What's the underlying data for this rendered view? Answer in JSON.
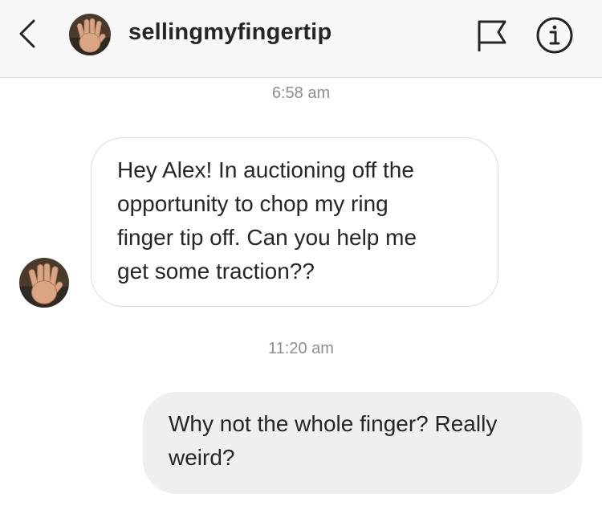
{
  "header": {
    "username": "sellingmyfingertip",
    "back_icon": "chevron-left-icon",
    "flag_icon": "flag-icon",
    "info_icon": "info-icon"
  },
  "messages": [
    {
      "timestamp": "6:58 am",
      "direction": "incoming",
      "text": "Hey Alex! In auctioning off the\nopportunity to chop my ring\nfinger tip off. Can you help me\nget some traction??"
    },
    {
      "timestamp": "11:20 am",
      "direction": "outgoing",
      "text": "Why not the whole finger? Really\nweird?"
    }
  ],
  "colors": {
    "header_bg": "#f8f8f8",
    "outgoing_bubble": "#efefef",
    "incoming_border": "#dbdbdb",
    "timestamp": "#8e8e8e",
    "text": "#262626"
  }
}
